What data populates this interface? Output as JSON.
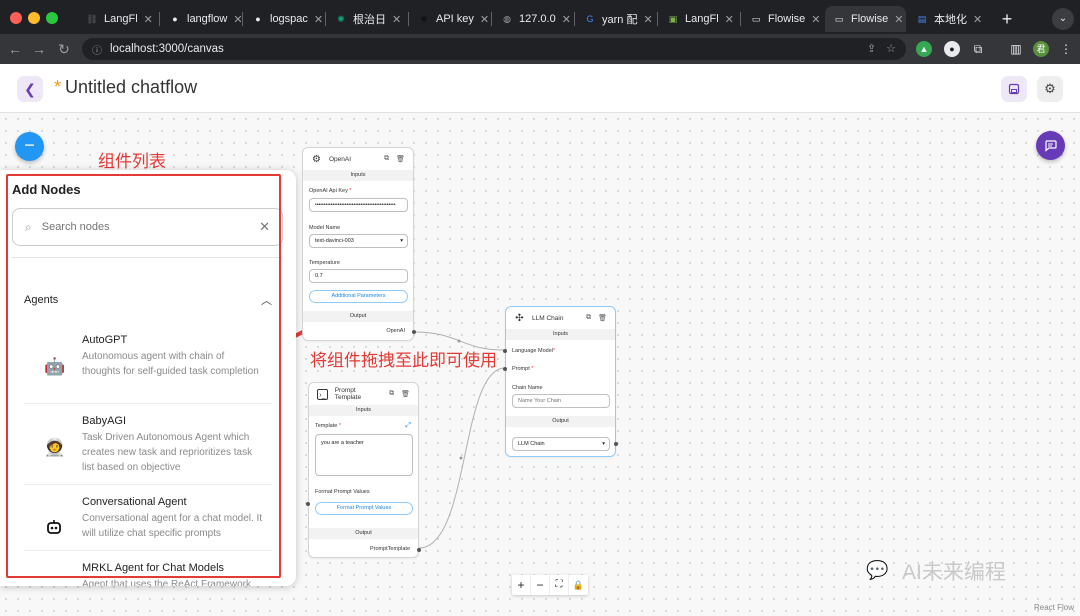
{
  "browser": {
    "tabs": [
      {
        "icon": "langflow-icon",
        "label": "LangFl",
        "active": false
      },
      {
        "icon": "github-icon",
        "label": "langflow",
        "active": false
      },
      {
        "icon": "github-icon",
        "label": "logspac",
        "active": false
      },
      {
        "icon": "chatgpt-icon",
        "label": "根治日",
        "active": false
      },
      {
        "icon": "openai-icon",
        "label": "API key",
        "active": false
      },
      {
        "icon": "globe-icon",
        "label": "127.0.0",
        "active": false
      },
      {
        "icon": "google-icon",
        "label": "yarn 配",
        "active": false
      },
      {
        "icon": "image-icon",
        "label": "LangFl",
        "active": false
      },
      {
        "icon": "page-icon",
        "label": "Flowise",
        "active": false
      },
      {
        "icon": "page-icon",
        "label": "Flowise",
        "active": true
      },
      {
        "icon": "docs-icon",
        "label": "本地化",
        "active": false
      }
    ],
    "url": "localhost:3000/canvas"
  },
  "header": {
    "unsaved_marker": "*",
    "title": "Untitled chatflow"
  },
  "annotations": {
    "panel_label": "组件列表",
    "drag_hint": "将组件拖拽至此即可使用"
  },
  "panel": {
    "title": "Add Nodes",
    "search_placeholder": "Search nodes",
    "category": "Agents",
    "items": [
      {
        "name": "AutoGPT",
        "description": "Autonomous agent with chain of thoughts for self-guided task completion",
        "icon": "autogpt-icon"
      },
      {
        "name": "BabyAGI",
        "description": "Task Driven Autonomous Agent which creates new task and reprioritizes task list based on objective",
        "icon": "babyagi-icon"
      },
      {
        "name": "Conversational Agent",
        "description": "Conversational agent for a chat model. It will utilize chat specific prompts",
        "icon": "robot-icon"
      },
      {
        "name": "MRKL Agent for Chat Models",
        "description": "Agent that uses the ReAct Framework",
        "icon": "robot-icon"
      }
    ]
  },
  "nodes": {
    "openai": {
      "title": "OpenAI",
      "inputs_label": "Inputs",
      "api_key_label": "OpenAI Api Key",
      "api_key_value": "••••••••••••••••••••••••••••••••••••••••••••••",
      "model_label": "Model Name",
      "model_value": "text-davinci-003",
      "temperature_label": "Temperature",
      "temperature_value": "0.7",
      "additional_button": "Additional Parameters",
      "output_label": "Output",
      "output_handle": "OpenAI"
    },
    "llm_chain": {
      "title": "LLM Chain",
      "inputs_label": "Inputs",
      "language_model_label": "Language Model",
      "prompt_label": "Prompt",
      "chain_name_label": "Chain Name",
      "chain_name_placeholder": "Name Your Chain",
      "output_label": "Output",
      "output_value": "LLM Chain"
    },
    "prompt_template": {
      "title": "Prompt Template",
      "inputs_label": "Inputs",
      "template_label": "Template",
      "template_value": "you are a teacher",
      "format_label": "Format Prompt Values",
      "format_button": "Format Prompt Values",
      "output_label": "Output",
      "output_handle": "PromptTemplate"
    }
  },
  "controls": {
    "zoom_in": "+",
    "zoom_out": "−",
    "fit": "⛶",
    "lock": "🔒"
  },
  "footer": {
    "react_flow": "React Flow",
    "watermark": "AI未来编程"
  }
}
